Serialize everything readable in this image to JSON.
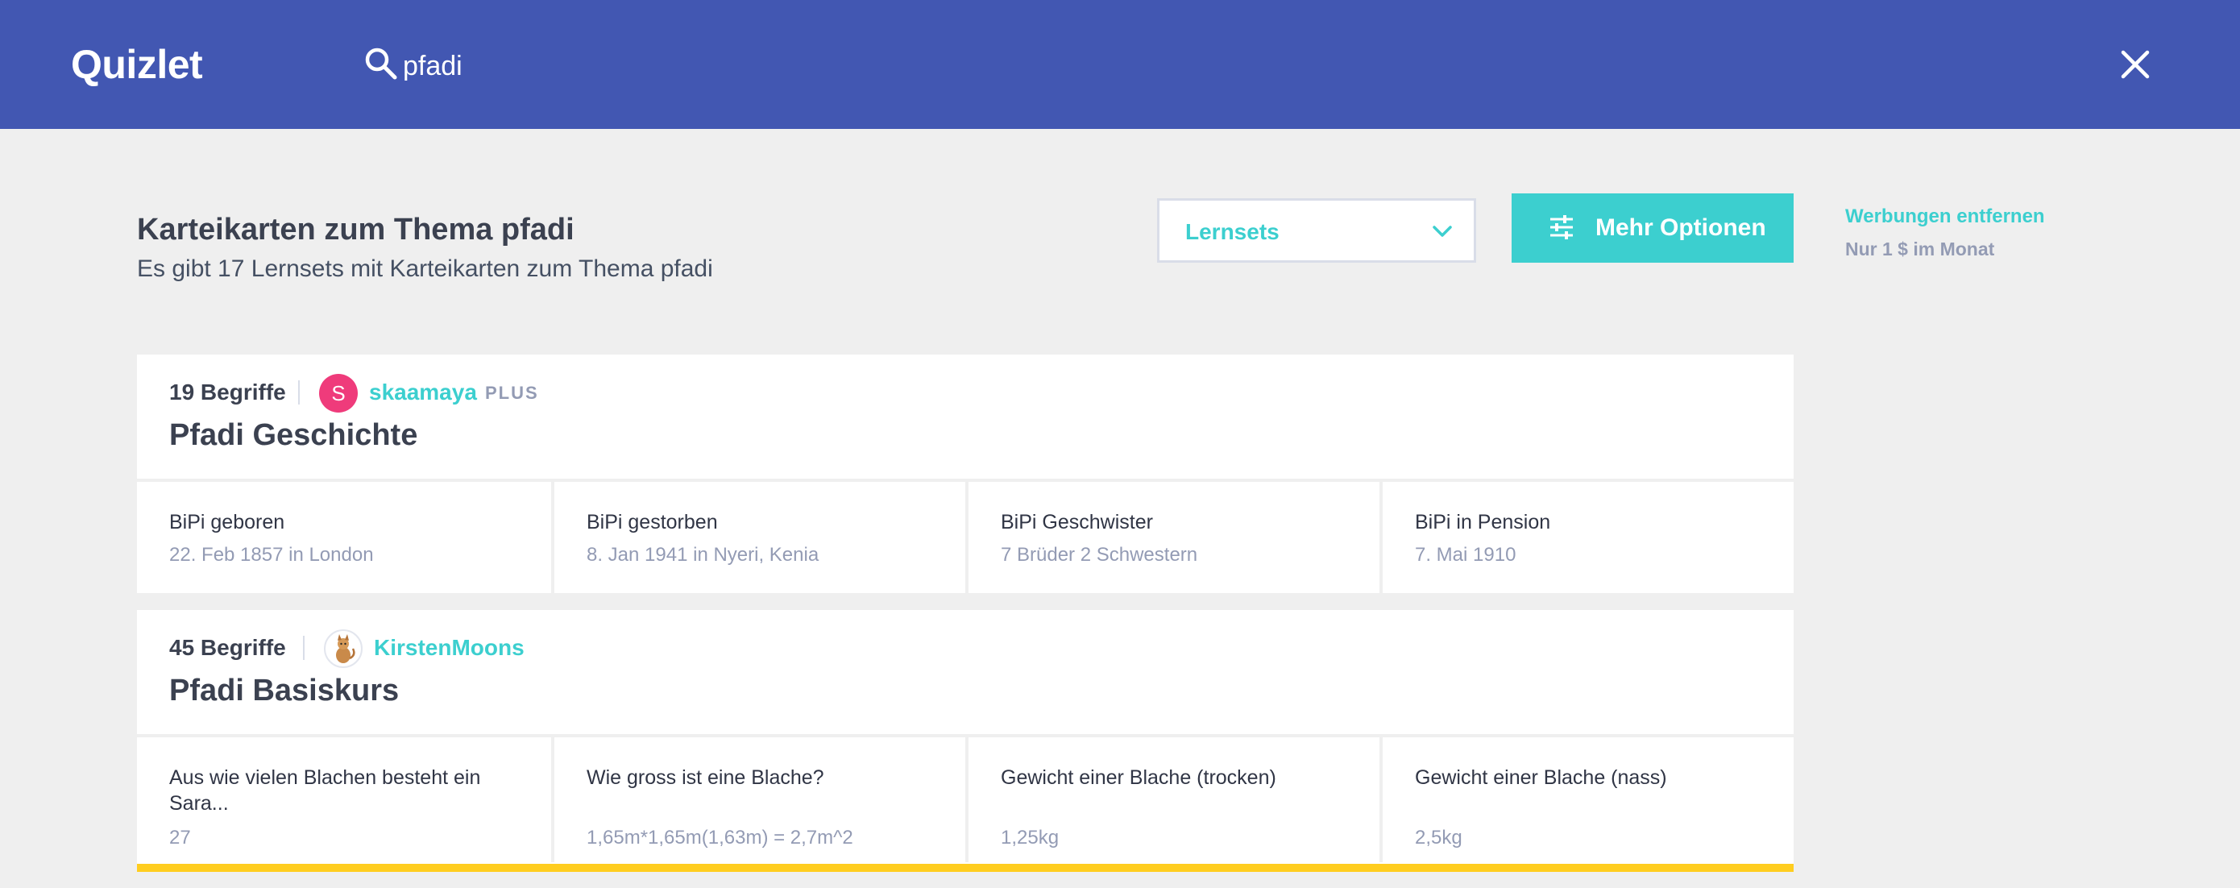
{
  "header": {
    "logo": "Quizlet",
    "search_value": "pfadi",
    "search_icon": "search-icon",
    "close_icon": "close-icon",
    "bar_color": "#4257b2"
  },
  "results": {
    "title": "Karteikarten zum Thema pfadi",
    "subtitle": "Es gibt 17 Lernsets mit Karteikarten zum Thema pfadi",
    "filter_selected": "Lernsets",
    "more_options_label": "Mehr Optionen",
    "ad_link": "Werbungen entfernen",
    "ad_sub": "Nur 1 $ im Monat"
  },
  "sets": [
    {
      "term_count": "19 Begriffe",
      "author": "skaamaya",
      "avatar_letter": "S",
      "badge": "PLUS",
      "title": "Pfadi Geschichte",
      "terms": [
        {
          "term": "BiPi geboren",
          "definition": "22. Feb 1857 in London"
        },
        {
          "term": "BiPi gestorben",
          "definition": "8. Jan 1941 in Nyeri, Kenia"
        },
        {
          "term": "BiPi Geschwister",
          "definition": "7 Brüder 2 Schwestern"
        },
        {
          "term": "BiPi in Pension",
          "definition": "7. Mai 1910"
        }
      ]
    },
    {
      "term_count": "45 Begriffe",
      "author": "KirstenMoons",
      "avatar_icon": "cat-avatar-icon",
      "title": "Pfadi Basiskurs",
      "terms": [
        {
          "term": "Aus wie vielen Blachen besteht ein Sara...",
          "definition": "27"
        },
        {
          "term": "Wie gross ist eine Blache?",
          "definition": "1,65m*1,65m(1,63m) = 2,7m^2"
        },
        {
          "term": "Gewicht einer Blache (trocken)",
          "definition": "1,25kg"
        },
        {
          "term": "Gewicht einer Blache (nass)",
          "definition": "2,5kg"
        }
      ]
    }
  ],
  "colors": {
    "accent": "#3ccfcf",
    "highlight": "#ffcd1f",
    "avatar_pink": "#ef3b7b"
  }
}
